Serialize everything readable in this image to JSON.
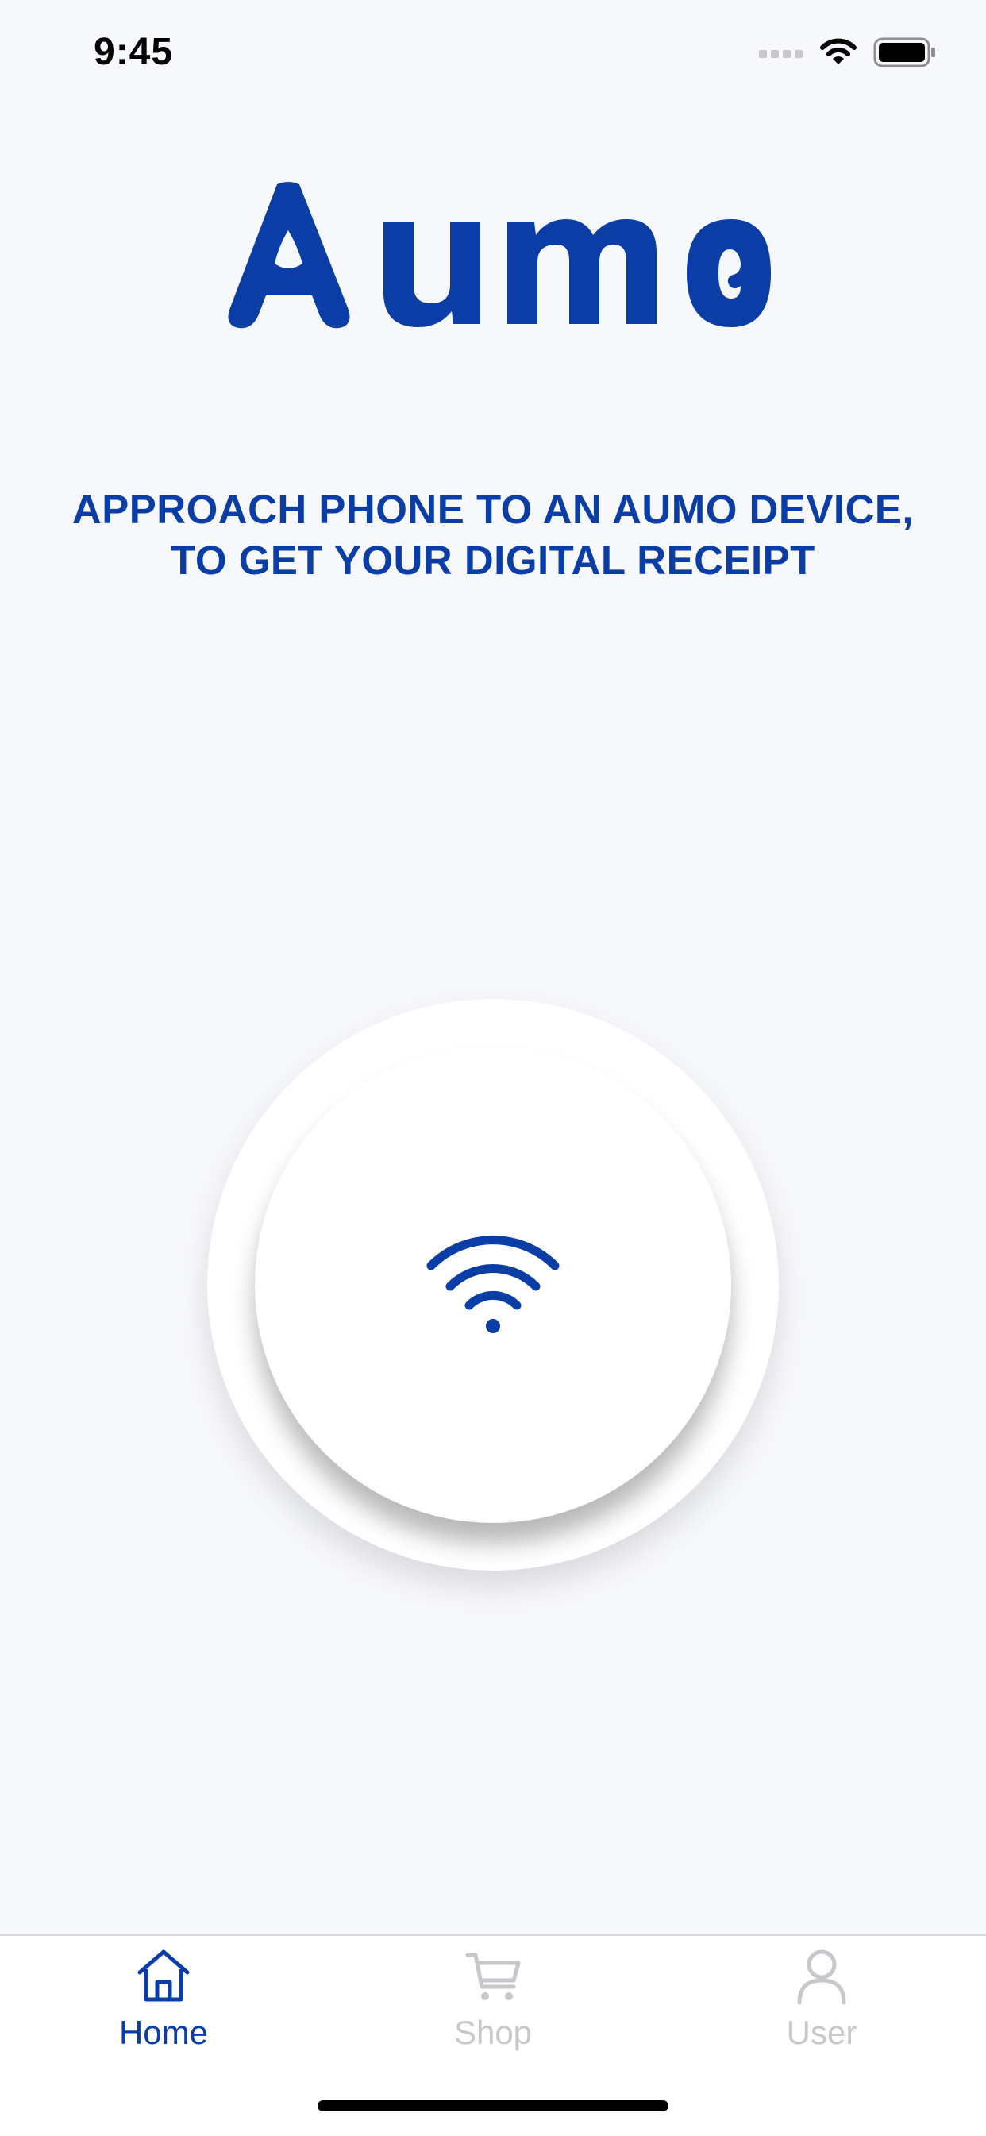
{
  "status_bar": {
    "time": "9:45"
  },
  "brand": {
    "logo_text": "Aumo",
    "color": "#0b3da7"
  },
  "main": {
    "instruction_line1": "APPROACH PHONE TO AN AUMO DEVICE,",
    "instruction_line2": "TO GET YOUR DIGITAL RECEIPT",
    "scan_button_icon": "wireless-signal-icon"
  },
  "tab_bar": {
    "active_color": "#0b3da7",
    "inactive_color": "#c7c7cc",
    "tabs": [
      {
        "label": "Home",
        "icon": "home-icon",
        "active": true
      },
      {
        "label": "Shop",
        "icon": "cart-icon",
        "active": false
      },
      {
        "label": "User",
        "icon": "user-icon",
        "active": false
      }
    ]
  }
}
